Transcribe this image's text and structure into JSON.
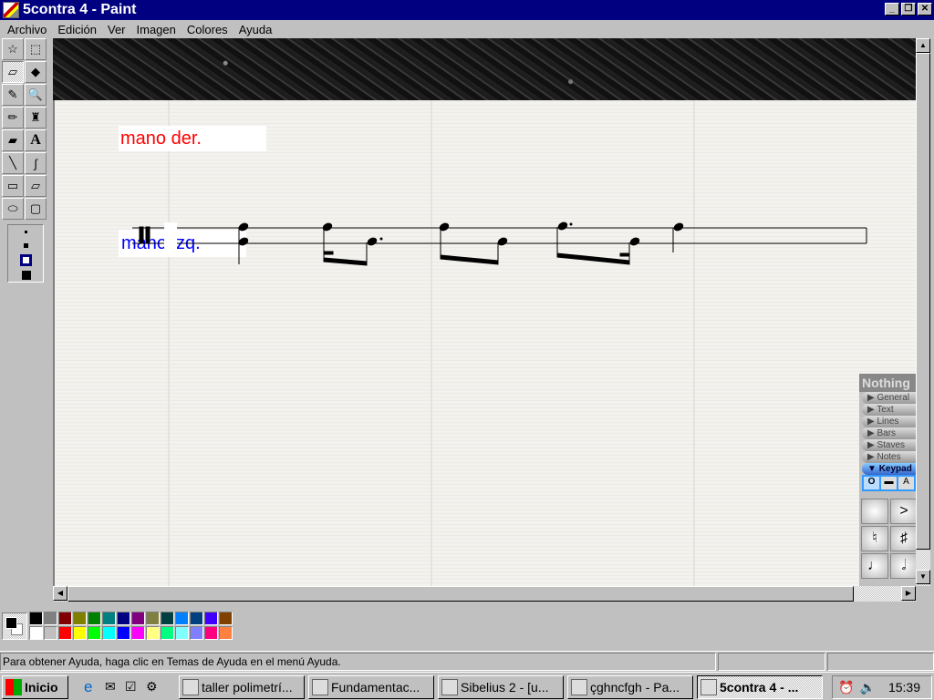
{
  "window": {
    "title": "5contra 4 - Paint",
    "buttons": [
      "minimize",
      "restore",
      "close"
    ]
  },
  "menu": [
    "Archivo",
    "Edición",
    "Ver",
    "Imagen",
    "Colores",
    "Ayuda"
  ],
  "tools": [
    {
      "name": "free-select",
      "glyph": "☆"
    },
    {
      "name": "rect-select",
      "glyph": "⬚"
    },
    {
      "name": "eraser",
      "glyph": "▱",
      "selected": true
    },
    {
      "name": "fill",
      "glyph": "◆"
    },
    {
      "name": "pick-color",
      "glyph": "✎"
    },
    {
      "name": "magnifier",
      "glyph": "🔍"
    },
    {
      "name": "pencil",
      "glyph": "✏"
    },
    {
      "name": "brush",
      "glyph": "♜"
    },
    {
      "name": "airbrush",
      "glyph": "▰"
    },
    {
      "name": "text",
      "glyph": "A"
    },
    {
      "name": "line",
      "glyph": "╲"
    },
    {
      "name": "curve",
      "glyph": "∫"
    },
    {
      "name": "rectangle",
      "glyph": "▭"
    },
    {
      "name": "polygon",
      "glyph": "▱"
    },
    {
      "name": "ellipse",
      "glyph": "⬭"
    },
    {
      "name": "rounded-rectangle",
      "glyph": "▢"
    }
  ],
  "canvas": {
    "label_right": "mano der.",
    "label_right_color": "#ff0000",
    "label_left": "mano izq.",
    "label_left_color": "#0000ff"
  },
  "sibelius": {
    "title": "Nothing",
    "sections": [
      "General",
      "Text",
      "Lines",
      "Bars",
      "Staves",
      "Notes"
    ],
    "active_section": "Keypad",
    "keys": [
      "",
      "&gt;",
      "♮",
      "♯",
      "♩",
      "𝅗𝅥"
    ]
  },
  "palette": {
    "foreground": "#000000",
    "background": "#ffffff",
    "top": [
      "#000000",
      "#808080",
      "#800000",
      "#808000",
      "#008000",
      "#008080",
      "#000080",
      "#800080",
      "#808040",
      "#004040",
      "#0080ff",
      "#004080",
      "#4000ff",
      "#804000"
    ],
    "bottom": [
      "#ffffff",
      "#c0c0c0",
      "#ff0000",
      "#ffff00",
      "#00ff00",
      "#00ffff",
      "#0000ff",
      "#ff00ff",
      "#ffff80",
      "#00ff80",
      "#80ffff",
      "#8080ff",
      "#ff0080",
      "#ff8040"
    ]
  },
  "status": {
    "text": "Para obtener Ayuda, haga clic en Temas de Ayuda en el menú Ayuda."
  },
  "taskbar": {
    "start": "Inicio",
    "tasks": [
      "taller polimetrí...",
      "Fundamentac...",
      "Sibelius 2 - [u...",
      "çghncfgh - Pa...",
      "5contra 4 - ..."
    ],
    "active_task": 4,
    "clock": "15:39"
  }
}
